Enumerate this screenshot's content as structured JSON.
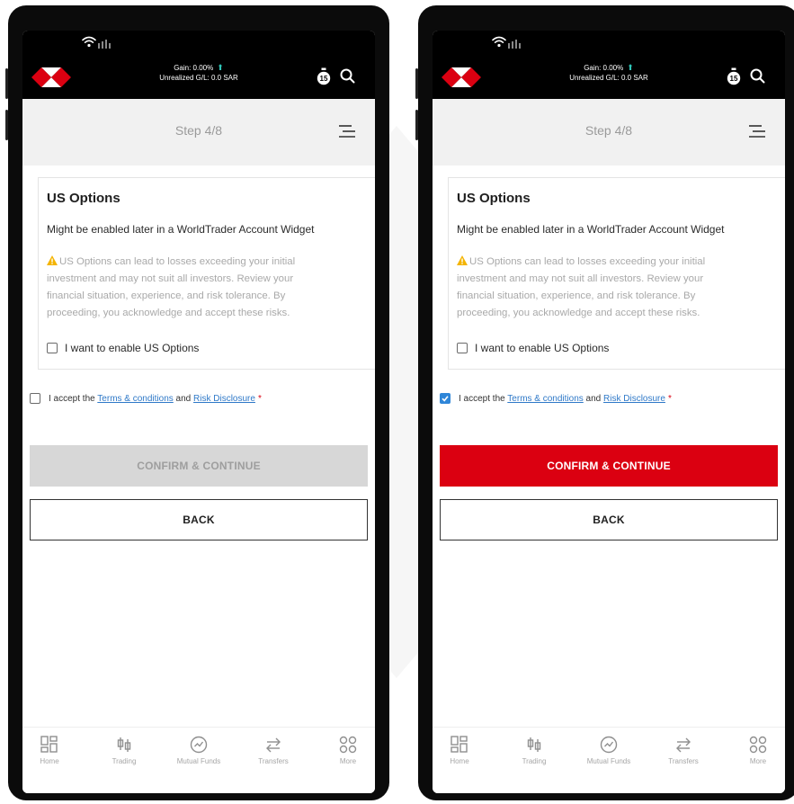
{
  "colors": {
    "brand_red": "#db0011",
    "checkbox_blue": "#2f86d8",
    "link_blue": "#2f79c8",
    "disabled_gray": "#d7d7d7",
    "gain_arrow_teal": "#2ec4b6"
  },
  "screens": [
    {
      "header": {
        "gain_text": "Gain: 0.00%",
        "unrealized_text": "Unrealized G/L: 0.0 SAR",
        "timer_badge": "15"
      },
      "step_label": "Step 4/8",
      "card": {
        "title": "US Options",
        "subtitle": "Might be enabled later in a WorldTrader Account Widget",
        "warning": "US Options can lead to losses exceeding your initial investment and may not suit all investors. Review your financial situation, experience, and risk tolerance. By proceeding, you acknowledge and accept these risks.",
        "enable_label": "I want to enable US Options",
        "enable_checked": false
      },
      "accept": {
        "prefix": "I accept the ",
        "terms_link": "Terms & conditions",
        "and": " and ",
        "risk_link": "Risk Disclosure",
        "required_mark": "*",
        "checked": false
      },
      "confirm_label": "CONFIRM & CONTINUE",
      "confirm_state": "disabled",
      "back_label": "BACK",
      "nav": [
        "Home",
        "Trading",
        "Mutual Funds",
        "Transfers",
        "More"
      ]
    },
    {
      "header": {
        "gain_text": "Gain: 0.00%",
        "unrealized_text": "Unrealized G/L: 0.0 SAR",
        "timer_badge": "15"
      },
      "step_label": "Step 4/8",
      "card": {
        "title": "US Options",
        "subtitle": "Might be enabled later in a WorldTrader Account Widget",
        "warning": "US Options can lead to losses exceeding your initial investment and may not suit all investors. Review your financial situation, experience, and risk tolerance. By proceeding, you acknowledge and accept these risks.",
        "enable_label": "I want to enable US Options",
        "enable_checked": false
      },
      "accept": {
        "prefix": "I accept the ",
        "terms_link": "Terms & conditions",
        "and": " and ",
        "risk_link": "Risk Disclosure",
        "required_mark": "*",
        "checked": true
      },
      "confirm_label": "CONFIRM & CONTINUE",
      "confirm_state": "enabled",
      "back_label": "BACK",
      "nav": [
        "Home",
        "Trading",
        "Mutual Funds",
        "Transfers",
        "More"
      ]
    }
  ]
}
